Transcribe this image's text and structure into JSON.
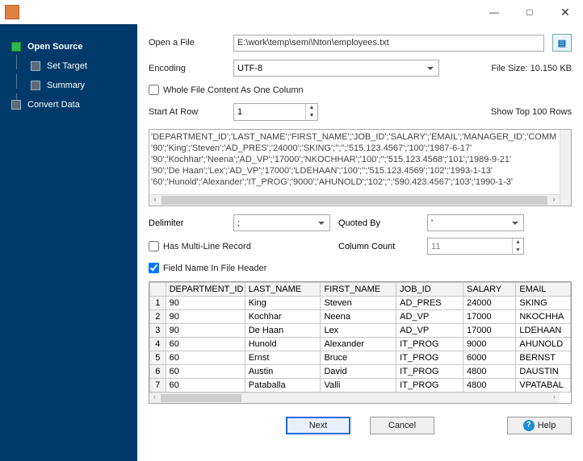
{
  "titlebar": {
    "min": "—",
    "max": "□",
    "close": "✕"
  },
  "sidebar": {
    "items": [
      {
        "label": "Open Source",
        "active": true
      },
      {
        "label": "Set Target"
      },
      {
        "label": "Summary"
      },
      {
        "label": "Convert Data"
      }
    ]
  },
  "openfile": {
    "label": "Open a File",
    "value": "E:\\work\\temp\\semi\\Nton\\employees.txt"
  },
  "encoding": {
    "label": "Encoding",
    "value": "UTF-8"
  },
  "filesize": {
    "label": "File Size: 10.150 KB"
  },
  "wholefile": {
    "label": "Whole File Content As One Column"
  },
  "startat": {
    "label": "Start At Row",
    "value": "1"
  },
  "showtop": {
    "label": "Show Top 100 Rows"
  },
  "preview": {
    "lines": [
      "'DEPARTMENT_ID';'LAST_NAME';'FIRST_NAME';'JOB_ID';'SALARY';'EMAIL';'MANAGER_ID';'COMM",
      "'90';'King';'Steven';'AD_PRES';'24000';'SKING';'';'';'515.123.4567';'100';'1987-6-17'",
      "'90';'Kochhar';'Neena';'AD_VP';'17000';'NKOCHHAR';'100';'';'515.123.4568';'101';'1989-9-21'",
      "'90';'De Haan';'Lex';'AD_VP';'17000';'LDEHAAN';'100';'';'515.123.4569';'102';'1993-1-13'",
      "'60';'Hunold';'Alexander';'IT_PROG';'9000';'AHUNOLD';'102';'';'590.423.4567';'103';'1990-1-3'"
    ]
  },
  "delimiter": {
    "label": "Delimiter",
    "value": ";"
  },
  "quotedby": {
    "label": "Quoted By",
    "value": "'"
  },
  "multiline": {
    "label": "Has Multi-Line Record"
  },
  "colcount": {
    "label": "Column Count",
    "value": "11"
  },
  "fieldname": {
    "label": "Field Name In File Header"
  },
  "table": {
    "headers": [
      "DEPARTMENT_ID",
      "LAST_NAME",
      "FIRST_NAME",
      "JOB_ID",
      "SALARY",
      "EMAIL"
    ],
    "rows": [
      [
        "90",
        "King",
        "Steven",
        "AD_PRES",
        "24000",
        "SKING"
      ],
      [
        "90",
        "Kochhar",
        "Neena",
        "AD_VP",
        "17000",
        "NKOCHHA"
      ],
      [
        "90",
        "De Haan",
        "Lex",
        "AD_VP",
        "17000",
        "LDEHAAN"
      ],
      [
        "60",
        "Hunold",
        "Alexander",
        "IT_PROG",
        "9000",
        "AHUNOLD"
      ],
      [
        "60",
        "Ernst",
        "Bruce",
        "IT_PROG",
        "6000",
        "BERNST"
      ],
      [
        "60",
        "Austin",
        "David",
        "IT_PROG",
        "4800",
        "DAUSTIN"
      ],
      [
        "60",
        "Pataballa",
        "Valli",
        "IT_PROG",
        "4800",
        "VPATABAL"
      ]
    ]
  },
  "buttons": {
    "next": "Next",
    "cancel": "Cancel",
    "help": "Help"
  }
}
